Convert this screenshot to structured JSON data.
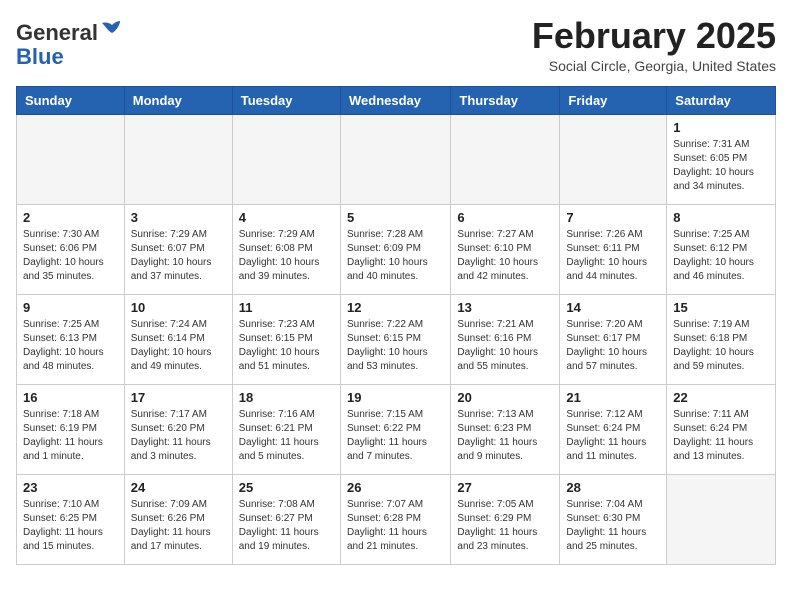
{
  "header": {
    "logo_general": "General",
    "logo_blue": "Blue",
    "month_title": "February 2025",
    "location": "Social Circle, Georgia, United States"
  },
  "weekdays": [
    "Sunday",
    "Monday",
    "Tuesday",
    "Wednesday",
    "Thursday",
    "Friday",
    "Saturday"
  ],
  "weeks": [
    [
      {
        "day": "",
        "info": ""
      },
      {
        "day": "",
        "info": ""
      },
      {
        "day": "",
        "info": ""
      },
      {
        "day": "",
        "info": ""
      },
      {
        "day": "",
        "info": ""
      },
      {
        "day": "",
        "info": ""
      },
      {
        "day": "1",
        "info": "Sunrise: 7:31 AM\nSunset: 6:05 PM\nDaylight: 10 hours and 34 minutes."
      }
    ],
    [
      {
        "day": "2",
        "info": "Sunrise: 7:30 AM\nSunset: 6:06 PM\nDaylight: 10 hours and 35 minutes."
      },
      {
        "day": "3",
        "info": "Sunrise: 7:29 AM\nSunset: 6:07 PM\nDaylight: 10 hours and 37 minutes."
      },
      {
        "day": "4",
        "info": "Sunrise: 7:29 AM\nSunset: 6:08 PM\nDaylight: 10 hours and 39 minutes."
      },
      {
        "day": "5",
        "info": "Sunrise: 7:28 AM\nSunset: 6:09 PM\nDaylight: 10 hours and 40 minutes."
      },
      {
        "day": "6",
        "info": "Sunrise: 7:27 AM\nSunset: 6:10 PM\nDaylight: 10 hours and 42 minutes."
      },
      {
        "day": "7",
        "info": "Sunrise: 7:26 AM\nSunset: 6:11 PM\nDaylight: 10 hours and 44 minutes."
      },
      {
        "day": "8",
        "info": "Sunrise: 7:25 AM\nSunset: 6:12 PM\nDaylight: 10 hours and 46 minutes."
      }
    ],
    [
      {
        "day": "9",
        "info": "Sunrise: 7:25 AM\nSunset: 6:13 PM\nDaylight: 10 hours and 48 minutes."
      },
      {
        "day": "10",
        "info": "Sunrise: 7:24 AM\nSunset: 6:14 PM\nDaylight: 10 hours and 49 minutes."
      },
      {
        "day": "11",
        "info": "Sunrise: 7:23 AM\nSunset: 6:15 PM\nDaylight: 10 hours and 51 minutes."
      },
      {
        "day": "12",
        "info": "Sunrise: 7:22 AM\nSunset: 6:15 PM\nDaylight: 10 hours and 53 minutes."
      },
      {
        "day": "13",
        "info": "Sunrise: 7:21 AM\nSunset: 6:16 PM\nDaylight: 10 hours and 55 minutes."
      },
      {
        "day": "14",
        "info": "Sunrise: 7:20 AM\nSunset: 6:17 PM\nDaylight: 10 hours and 57 minutes."
      },
      {
        "day": "15",
        "info": "Sunrise: 7:19 AM\nSunset: 6:18 PM\nDaylight: 10 hours and 59 minutes."
      }
    ],
    [
      {
        "day": "16",
        "info": "Sunrise: 7:18 AM\nSunset: 6:19 PM\nDaylight: 11 hours and 1 minute."
      },
      {
        "day": "17",
        "info": "Sunrise: 7:17 AM\nSunset: 6:20 PM\nDaylight: 11 hours and 3 minutes."
      },
      {
        "day": "18",
        "info": "Sunrise: 7:16 AM\nSunset: 6:21 PM\nDaylight: 11 hours and 5 minutes."
      },
      {
        "day": "19",
        "info": "Sunrise: 7:15 AM\nSunset: 6:22 PM\nDaylight: 11 hours and 7 minutes."
      },
      {
        "day": "20",
        "info": "Sunrise: 7:13 AM\nSunset: 6:23 PM\nDaylight: 11 hours and 9 minutes."
      },
      {
        "day": "21",
        "info": "Sunrise: 7:12 AM\nSunset: 6:24 PM\nDaylight: 11 hours and 11 minutes."
      },
      {
        "day": "22",
        "info": "Sunrise: 7:11 AM\nSunset: 6:24 PM\nDaylight: 11 hours and 13 minutes."
      }
    ],
    [
      {
        "day": "23",
        "info": "Sunrise: 7:10 AM\nSunset: 6:25 PM\nDaylight: 11 hours and 15 minutes."
      },
      {
        "day": "24",
        "info": "Sunrise: 7:09 AM\nSunset: 6:26 PM\nDaylight: 11 hours and 17 minutes."
      },
      {
        "day": "25",
        "info": "Sunrise: 7:08 AM\nSunset: 6:27 PM\nDaylight: 11 hours and 19 minutes."
      },
      {
        "day": "26",
        "info": "Sunrise: 7:07 AM\nSunset: 6:28 PM\nDaylight: 11 hours and 21 minutes."
      },
      {
        "day": "27",
        "info": "Sunrise: 7:05 AM\nSunset: 6:29 PM\nDaylight: 11 hours and 23 minutes."
      },
      {
        "day": "28",
        "info": "Sunrise: 7:04 AM\nSunset: 6:30 PM\nDaylight: 11 hours and 25 minutes."
      },
      {
        "day": "",
        "info": ""
      }
    ]
  ]
}
